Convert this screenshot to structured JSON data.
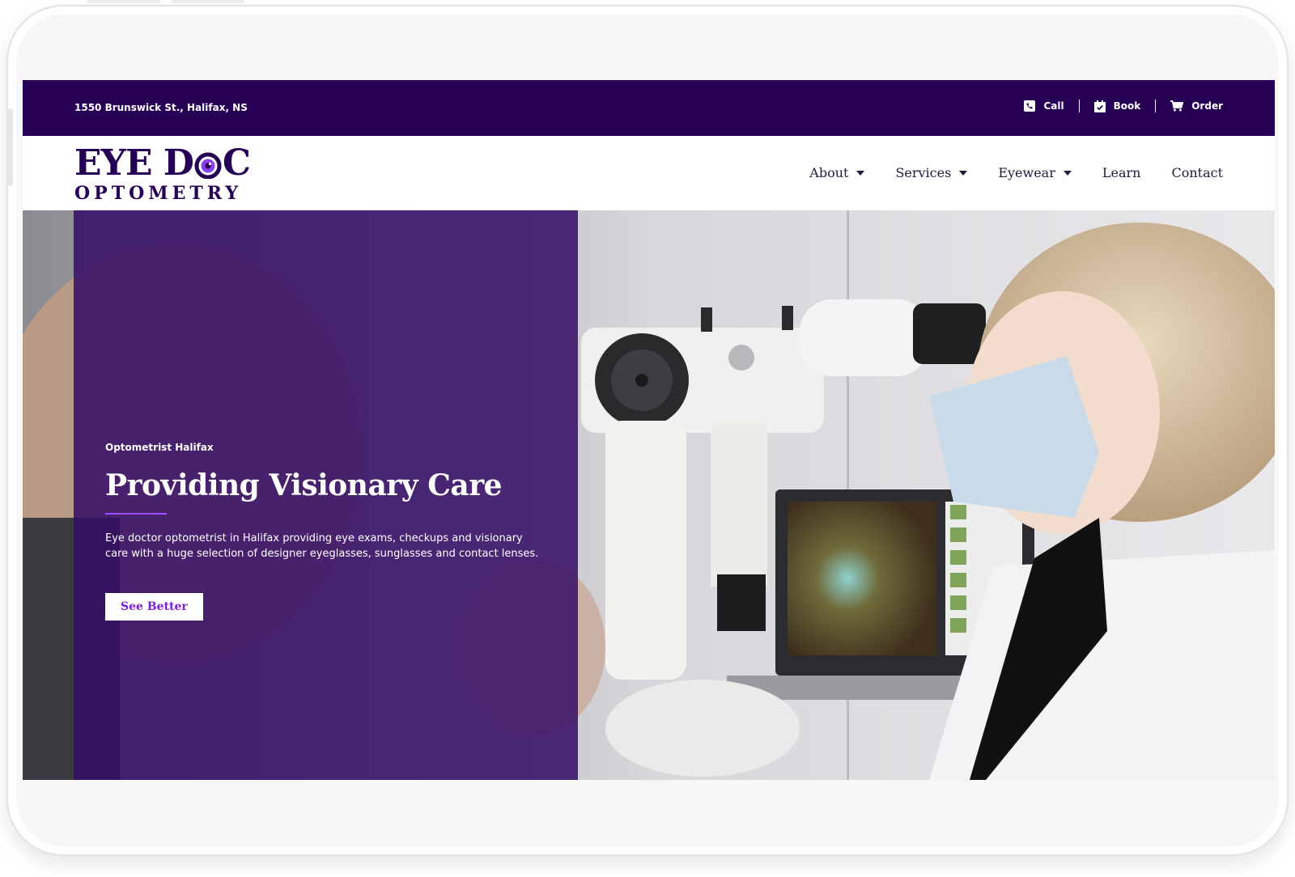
{
  "topbar": {
    "address": "1550 Brunswick St., Halifax, NS",
    "actions": [
      {
        "label": "Call",
        "icon": "phone-icon"
      },
      {
        "label": "Book",
        "icon": "calendar-check-icon"
      },
      {
        "label": "Order",
        "icon": "cart-icon"
      }
    ]
  },
  "header": {
    "logo": {
      "line1_a": "EYE D",
      "line1_b": "C",
      "line2": "OPTOMETRY"
    },
    "nav": [
      {
        "label": "About",
        "has_dropdown": true
      },
      {
        "label": "Services",
        "has_dropdown": true
      },
      {
        "label": "Eyewear",
        "has_dropdown": true
      },
      {
        "label": "Learn",
        "has_dropdown": false
      },
      {
        "label": "Contact",
        "has_dropdown": false
      }
    ]
  },
  "hero": {
    "eyebrow": "Optometrist Halifax",
    "headline": "Providing Visionary Care",
    "description": "Eye doctor optometrist in Halifax providing eye exams, checkups and visionary care with a huge selection of designer eyeglasses, sunglasses and contact lenses.",
    "cta_label": "See Better"
  },
  "colors": {
    "brand_dark": "#250054",
    "overlay": "#340d66",
    "accent": "#9b4dff",
    "cta_text": "#7a1fcf"
  }
}
